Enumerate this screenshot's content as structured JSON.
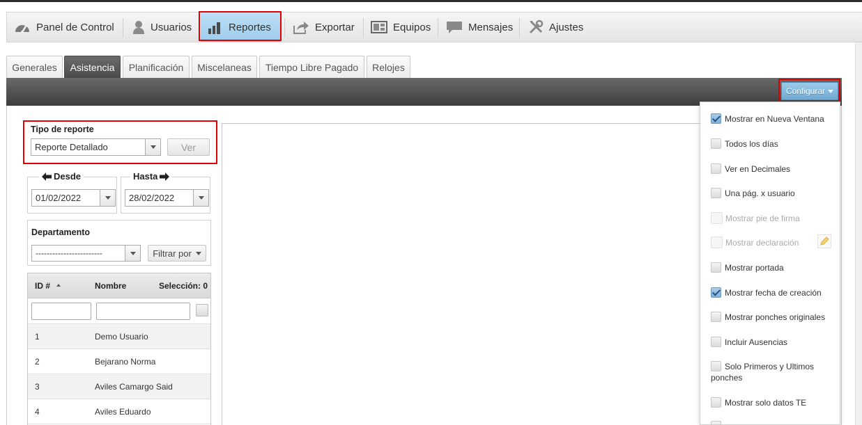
{
  "nav": {
    "items": [
      {
        "label": "Panel de Control",
        "icon": "dashboard-icon"
      },
      {
        "label": "Usuarios",
        "icon": "user-icon"
      },
      {
        "label": "Reportes",
        "icon": "bar-chart-icon",
        "active": true
      },
      {
        "label": "Exportar",
        "icon": "export-icon"
      },
      {
        "label": "Equipos",
        "icon": "devices-icon"
      },
      {
        "label": "Mensajes",
        "icon": "message-icon"
      },
      {
        "label": "Ajustes",
        "icon": "tools-icon"
      }
    ]
  },
  "tabs": [
    {
      "label": "Generales"
    },
    {
      "label": "Asistencia",
      "active": true
    },
    {
      "label": "Planificación"
    },
    {
      "label": "Miscelaneas"
    },
    {
      "label": "Tiempo Libre Pagado"
    },
    {
      "label": "Relojes"
    }
  ],
  "toolbar": {
    "configure_label": "Configurar"
  },
  "report": {
    "type_label": "Tipo de reporte",
    "type_value": "Reporte Detallado",
    "view_label": "Ver"
  },
  "dates": {
    "from_label": "Desde",
    "from_value": "01/02/2022",
    "to_label": "Hasta",
    "to_value": "28/02/2022"
  },
  "department": {
    "label": "Departamento",
    "value": "------------------------",
    "filter_label": "Filtrar por"
  },
  "grid": {
    "col_id": "ID #",
    "col_name": "Nombre",
    "col_selection": "Selección: 0",
    "rows": [
      {
        "id": "1",
        "name": "Demo Usuario"
      },
      {
        "id": "2",
        "name": "Bejarano Norma"
      },
      {
        "id": "3",
        "name": "Aviles Camargo Said"
      },
      {
        "id": "4",
        "name": "Aviles Eduardo"
      }
    ]
  },
  "config_menu": {
    "items": [
      {
        "label": "Mostrar en Nueva Ventana",
        "checked": true,
        "disabled": false
      },
      {
        "label": "Todos los días",
        "checked": false,
        "disabled": false
      },
      {
        "label": "Ver en Decimales",
        "checked": false,
        "disabled": false
      },
      {
        "label": "Una pág. x usuario",
        "checked": false,
        "disabled": false
      },
      {
        "label": "Mostrar pie de firma",
        "checked": false,
        "disabled": true
      },
      {
        "label": "Mostrar declaración",
        "checked": false,
        "disabled": true
      },
      {
        "label": "Mostrar portada",
        "checked": false,
        "disabled": false
      },
      {
        "label": "Mostrar fecha de creación",
        "checked": true,
        "disabled": false
      },
      {
        "label": "Mostrar ponches originales",
        "checked": false,
        "disabled": false
      },
      {
        "label": "Incluir Ausencias",
        "checked": false,
        "disabled": false
      },
      {
        "label": "Solo Primeros y Ultimos ponches",
        "checked": false,
        "disabled": false
      },
      {
        "label": "Mostrar solo datos TE",
        "checked": false,
        "disabled": false
      }
    ]
  },
  "colors": {
    "active_nav": "#9ccbea",
    "highlight_box": "#e00000",
    "toolbar_dark": "#4a4a4a",
    "config_button": "#6fa9d1"
  }
}
